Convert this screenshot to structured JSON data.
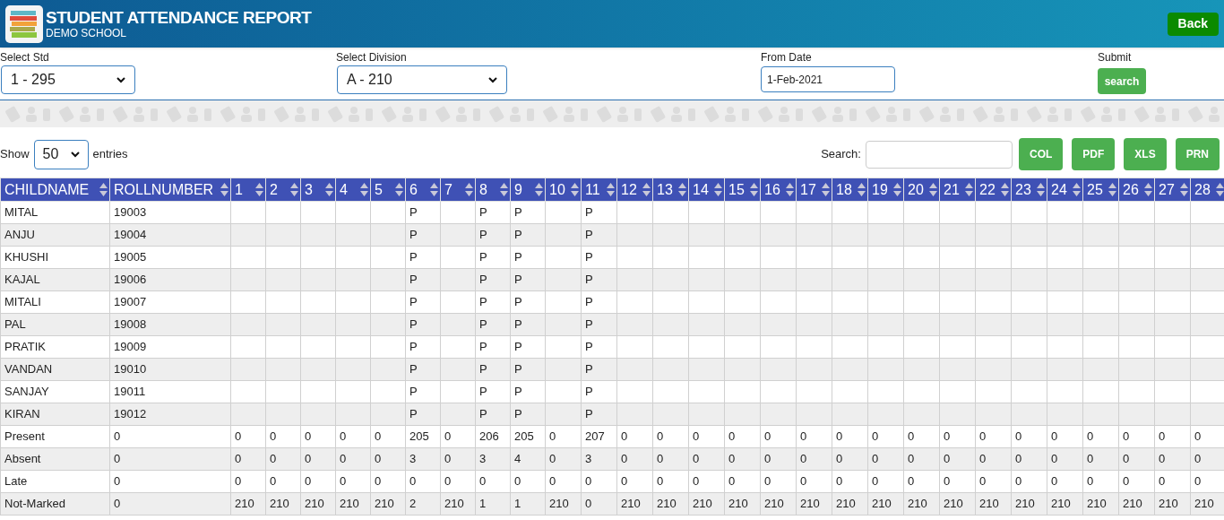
{
  "header": {
    "title": "STUDENT ATTENDANCE REPORT",
    "subtitle": "DEMO SCHOOL",
    "back_button": "Back"
  },
  "filters": [
    {
      "label": "Select Std",
      "kind": "select",
      "value": "1 - 295"
    },
    {
      "label": "Select Division",
      "kind": "select",
      "value": "A - 210"
    },
    {
      "label": "From Date",
      "kind": "date",
      "value": "1-Feb-2021"
    },
    {
      "label": "Submit",
      "kind": "button",
      "value": "search"
    }
  ],
  "table_controls": {
    "show_label": "Show",
    "page_size": "50",
    "entries_label": "entries",
    "search_label": "Search:",
    "buttons": [
      "COL",
      "PDF",
      "XLS",
      "PRN"
    ]
  },
  "table": {
    "columns": [
      "CHILDNAME",
      "ROLLNUMBER",
      "1",
      "2",
      "3",
      "4",
      "5",
      "6",
      "7",
      "8",
      "9",
      "10",
      "11",
      "12",
      "13",
      "14",
      "15",
      "16",
      "17",
      "18",
      "19",
      "20",
      "21",
      "22",
      "23",
      "24",
      "25",
      "26",
      "27",
      "28"
    ],
    "rows": [
      {
        "cells": [
          "MITAL",
          "19003",
          null,
          null,
          null,
          null,
          null,
          "P",
          null,
          "P",
          "P",
          null,
          "P",
          null,
          null,
          null,
          null,
          null,
          null,
          null,
          null,
          null,
          null,
          null,
          null,
          null,
          null,
          null,
          null,
          null
        ]
      },
      {
        "cells": [
          "ANJU",
          "19004",
          null,
          null,
          null,
          null,
          null,
          "P",
          null,
          "P",
          "P",
          null,
          "P",
          null,
          null,
          null,
          null,
          null,
          null,
          null,
          null,
          null,
          null,
          null,
          null,
          null,
          null,
          null,
          null,
          null
        ]
      },
      {
        "cells": [
          "KHUSHI",
          "19005",
          null,
          null,
          null,
          null,
          null,
          "P",
          null,
          "P",
          "P",
          null,
          "P",
          null,
          null,
          null,
          null,
          null,
          null,
          null,
          null,
          null,
          null,
          null,
          null,
          null,
          null,
          null,
          null,
          null
        ]
      },
      {
        "cells": [
          "KAJAL",
          "19006",
          null,
          null,
          null,
          null,
          null,
          "P",
          null,
          "P",
          "P",
          null,
          "P",
          null,
          null,
          null,
          null,
          null,
          null,
          null,
          null,
          null,
          null,
          null,
          null,
          null,
          null,
          null,
          null,
          null
        ]
      },
      {
        "cells": [
          "MITALI",
          "19007",
          null,
          null,
          null,
          null,
          null,
          "P",
          null,
          "P",
          "P",
          null,
          "P",
          null,
          null,
          null,
          null,
          null,
          null,
          null,
          null,
          null,
          null,
          null,
          null,
          null,
          null,
          null,
          null,
          null
        ]
      },
      {
        "cells": [
          "PAL",
          "19008",
          null,
          null,
          null,
          null,
          null,
          "P",
          null,
          "P",
          "P",
          null,
          "P",
          null,
          null,
          null,
          null,
          null,
          null,
          null,
          null,
          null,
          null,
          null,
          null,
          null,
          null,
          null,
          null,
          null
        ]
      },
      {
        "cells": [
          "PRATIK",
          "19009",
          null,
          null,
          null,
          null,
          null,
          "P",
          null,
          "P",
          "P",
          null,
          "P",
          null,
          null,
          null,
          null,
          null,
          null,
          null,
          null,
          null,
          null,
          null,
          null,
          null,
          null,
          null,
          null,
          null
        ]
      },
      {
        "cells": [
          "VANDAN",
          "19010",
          null,
          null,
          null,
          null,
          null,
          "P",
          null,
          "P",
          "P",
          null,
          "P",
          null,
          null,
          null,
          null,
          null,
          null,
          null,
          null,
          null,
          null,
          null,
          null,
          null,
          null,
          null,
          null,
          null
        ]
      },
      {
        "cells": [
          "SANJAY",
          "19011",
          null,
          null,
          null,
          null,
          null,
          "P",
          null,
          "P",
          "P",
          null,
          "P",
          null,
          null,
          null,
          null,
          null,
          null,
          null,
          null,
          null,
          null,
          null,
          null,
          null,
          null,
          null,
          null,
          null
        ]
      },
      {
        "cells": [
          "KIRAN",
          "19012",
          null,
          null,
          null,
          null,
          null,
          "P",
          null,
          "P",
          "P",
          null,
          "P",
          null,
          null,
          null,
          null,
          null,
          null,
          null,
          null,
          null,
          null,
          null,
          null,
          null,
          null,
          null,
          null,
          null
        ]
      },
      {
        "cells": [
          "Present",
          "0",
          "0",
          "0",
          "0",
          "0",
          "0",
          "205",
          "0",
          "206",
          "205",
          "0",
          "207",
          "0",
          "0",
          "0",
          "0",
          "0",
          "0",
          "0",
          "0",
          "0",
          "0",
          "0",
          "0",
          "0",
          "0",
          "0",
          "0",
          "0"
        ]
      },
      {
        "cells": [
          "Absent",
          "0",
          "0",
          "0",
          "0",
          "0",
          "0",
          "3",
          "0",
          "3",
          "4",
          "0",
          "3",
          "0",
          "0",
          "0",
          "0",
          "0",
          "0",
          "0",
          "0",
          "0",
          "0",
          "0",
          "0",
          "0",
          "0",
          "0",
          "0",
          "0"
        ]
      },
      {
        "cells": [
          "Late",
          "0",
          "0",
          "0",
          "0",
          "0",
          "0",
          "0",
          "0",
          "0",
          "0",
          "0",
          "0",
          "0",
          "0",
          "0",
          "0",
          "0",
          "0",
          "0",
          "0",
          "0",
          "0",
          "0",
          "0",
          "0",
          "0",
          "0",
          "0",
          "0"
        ]
      },
      {
        "cells": [
          "Not-Marked",
          "0",
          "210",
          "210",
          "210",
          "210",
          "210",
          "2",
          "210",
          "1",
          "1",
          "210",
          "0",
          "210",
          "210",
          "210",
          "210",
          "210",
          "210",
          "210",
          "210",
          "210",
          "210",
          "210",
          "210",
          "210",
          "210",
          "210",
          "210",
          "210"
        ]
      }
    ]
  }
}
